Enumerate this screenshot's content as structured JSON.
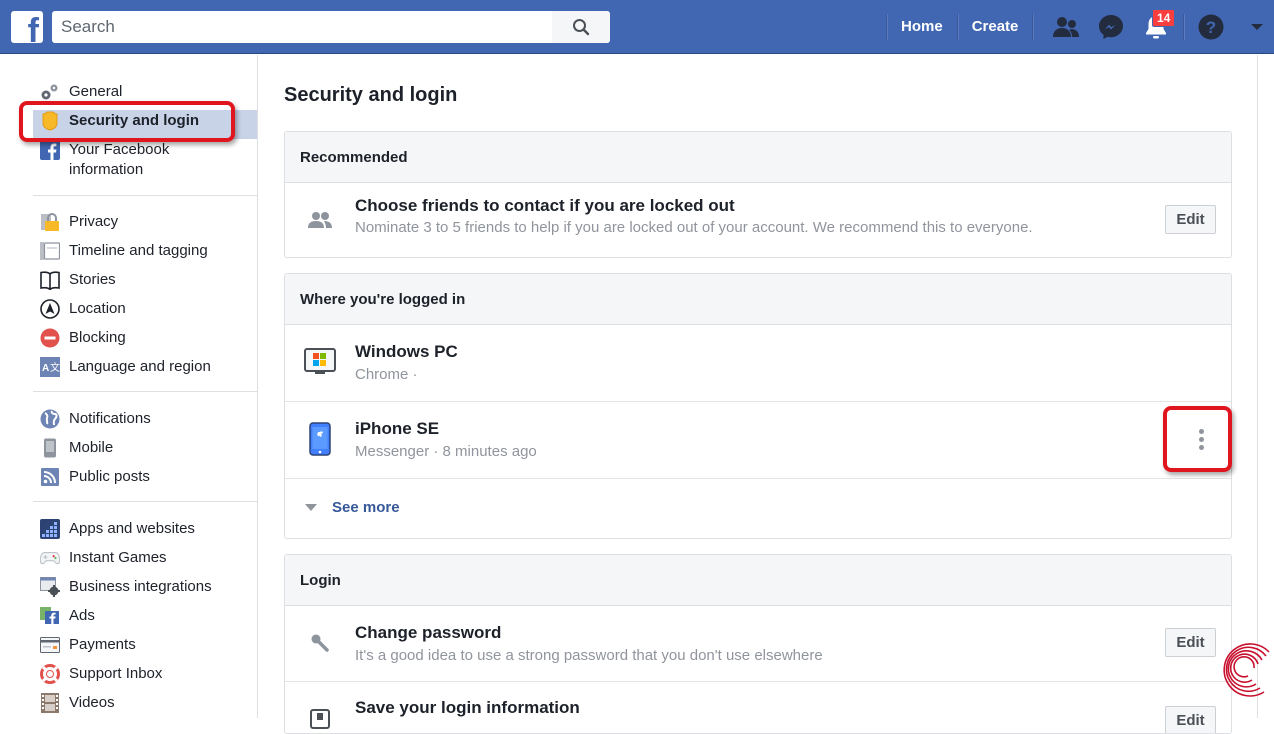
{
  "topbar": {
    "logo": "f",
    "search_placeholder": "Search",
    "nav": {
      "home": "Home",
      "create": "Create"
    },
    "notifications_count": "14",
    "colors": {
      "brand": "#4267b2",
      "badge": "#fa3e3e"
    }
  },
  "sidebar": {
    "groups": [
      {
        "items": [
          {
            "label": "General",
            "icon": "gears-icon"
          },
          {
            "label": "Security and login",
            "icon": "shield-icon",
            "active": true
          },
          {
            "label": "Your Facebook information",
            "icon": "facebook-icon"
          }
        ]
      },
      {
        "items": [
          {
            "label": "Privacy",
            "icon": "lock-icon"
          },
          {
            "label": "Timeline and tagging",
            "icon": "timeline-icon"
          },
          {
            "label": "Stories",
            "icon": "book-icon"
          },
          {
            "label": "Location",
            "icon": "location-icon"
          },
          {
            "label": "Blocking",
            "icon": "block-icon"
          },
          {
            "label": "Language and region",
            "icon": "language-icon"
          }
        ]
      },
      {
        "items": [
          {
            "label": "Notifications",
            "icon": "globe-icon"
          },
          {
            "label": "Mobile",
            "icon": "mobile-icon"
          },
          {
            "label": "Public posts",
            "icon": "rss-icon"
          }
        ]
      },
      {
        "items": [
          {
            "label": "Apps and websites",
            "icon": "apps-icon"
          },
          {
            "label": "Instant Games",
            "icon": "gamepad-icon"
          },
          {
            "label": "Business integrations",
            "icon": "business-gear-icon"
          },
          {
            "label": "Ads",
            "icon": "ads-icon"
          },
          {
            "label": "Payments",
            "icon": "credit-card-icon"
          },
          {
            "label": "Support Inbox",
            "icon": "lifebuoy-icon"
          },
          {
            "label": "Videos",
            "icon": "film-icon"
          }
        ]
      }
    ]
  },
  "main": {
    "title": "Security and login",
    "recommended": {
      "header": "Recommended",
      "rows": [
        {
          "title": "Choose friends to contact if you are locked out",
          "subtitle": "Nominate 3 to 5 friends to help if you are locked out of your account. We recommend this to everyone.",
          "action": "Edit"
        }
      ]
    },
    "logged_in": {
      "header": "Where you're logged in",
      "sessions": [
        {
          "device": "Windows PC",
          "detail": "Chrome ·"
        },
        {
          "device": "iPhone SE",
          "detail": "Messenger · 8 minutes ago"
        }
      ],
      "see_more": "See more"
    },
    "login": {
      "header": "Login",
      "rows": [
        {
          "title": "Change password",
          "subtitle": "It's a good idea to use a strong password that you don't use elsewhere",
          "action": "Edit"
        },
        {
          "title": "Save your login information",
          "subtitle": "",
          "action": "Edit"
        }
      ]
    }
  }
}
